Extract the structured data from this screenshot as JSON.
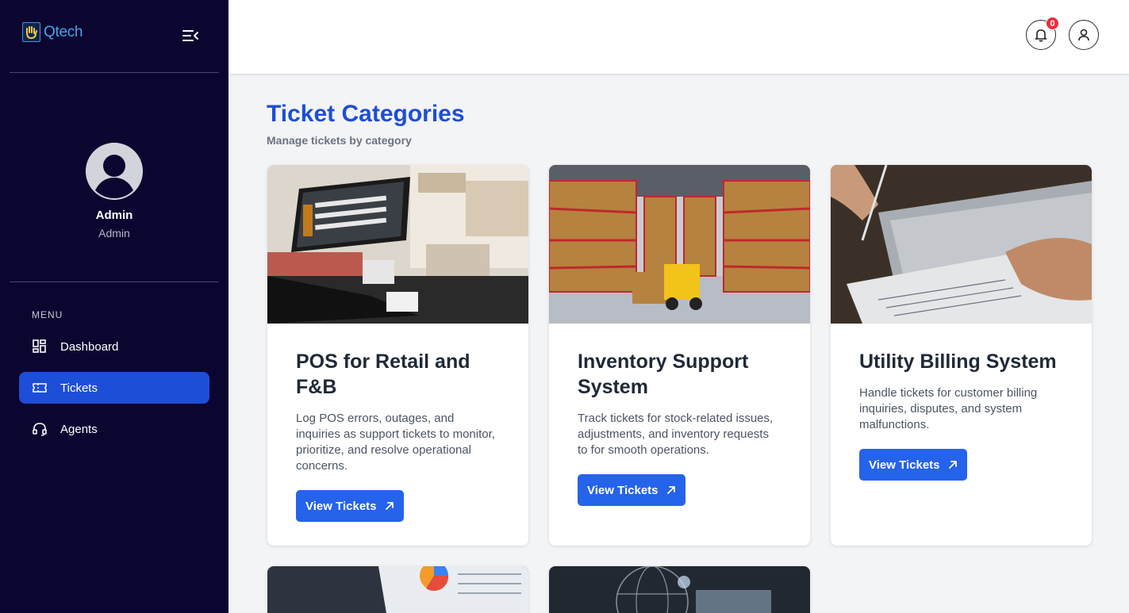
{
  "brand": {
    "name": "Qtech"
  },
  "profile": {
    "name": "Admin",
    "role": "Admin"
  },
  "menu": {
    "title": "MENU",
    "items": [
      {
        "label": "Dashboard",
        "icon": "dashboard-grid-icon",
        "active": false
      },
      {
        "label": "Tickets",
        "icon": "ticket-icon",
        "active": true
      },
      {
        "label": "Agents",
        "icon": "headset-icon",
        "active": false
      }
    ]
  },
  "topbar": {
    "notification_count": "0",
    "notification_icon": "bell-icon",
    "account_icon": "user-icon"
  },
  "page": {
    "title": "Ticket Categories",
    "subtitle": "Manage tickets by category"
  },
  "categories": [
    {
      "title": "POS for Retail and F&B",
      "description": "Log POS errors, outages, and inquiries as support tickets to monitor, prioritize, and resolve operational concerns.",
      "button": "View Tickets"
    },
    {
      "title": "Inventory Support System",
      "description": "Track tickets for stock-related issues, adjustments, and inventory requests to for smooth operations.",
      "button": "View Tickets"
    },
    {
      "title": "Utility Billing System",
      "description": "Handle tickets for customer billing inquiries, disputes, and system malfunctions.",
      "button": "View Tickets"
    }
  ],
  "colors": {
    "sidebar": "#0b0630",
    "accent": "#1d4ed8",
    "button": "#2563eb",
    "badge": "#ef2b3c"
  }
}
